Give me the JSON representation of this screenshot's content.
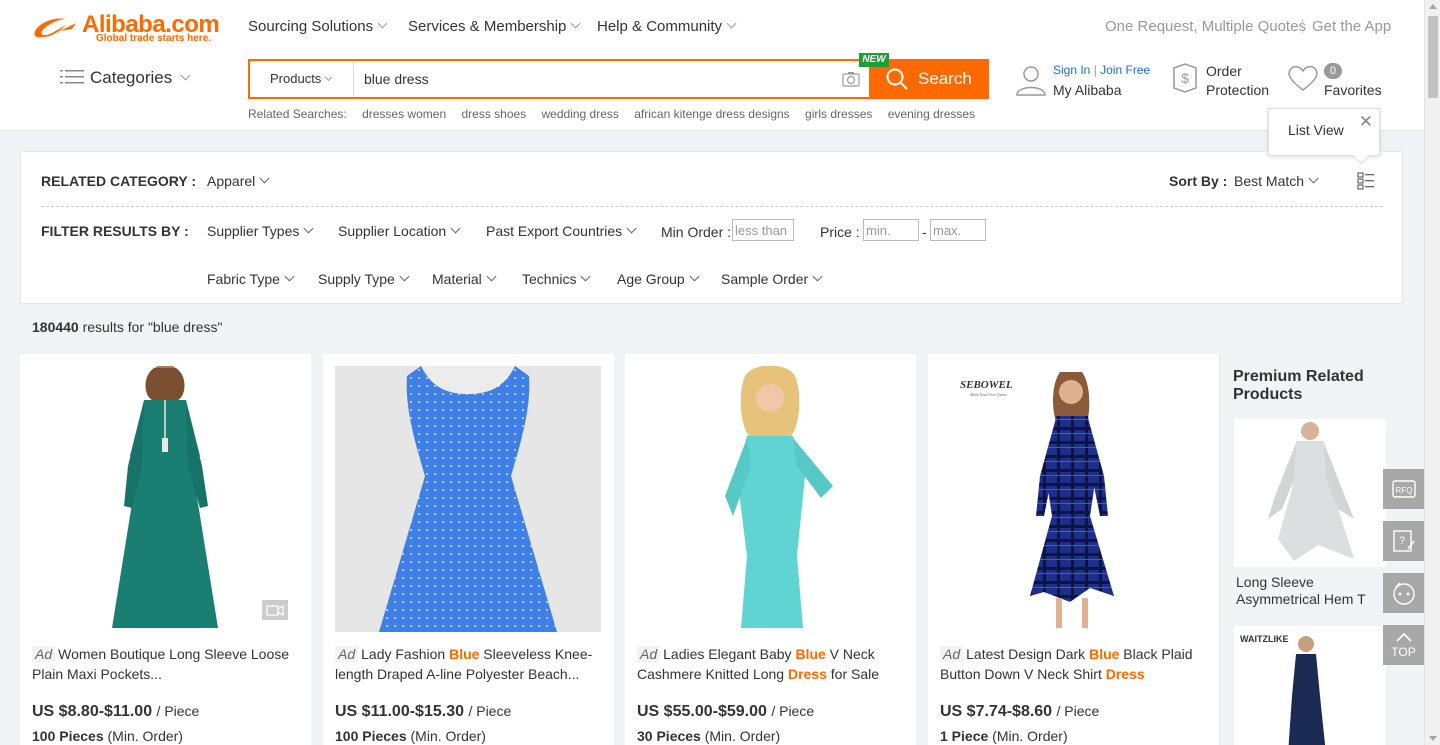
{
  "brand": {
    "name": "Alibaba.com",
    "tagline": "Global trade starts here.",
    "accent": "#ff6a00"
  },
  "topnav": {
    "sourcing": "Sourcing Solutions",
    "services": "Services & Membership",
    "help": "Help & Community",
    "one_request": "One Request, Multiple Quotes",
    "get_app": "Get the App"
  },
  "categories_label": "Categories",
  "search": {
    "type": "Products",
    "query": "blue dress",
    "button": "Search",
    "new_badge": "NEW",
    "related_label": "Related Searches:",
    "related": [
      "dresses women",
      "dress shoes",
      "wedding dress",
      "african kitenge dress designs",
      "girls dresses",
      "evening dresses"
    ]
  },
  "account": {
    "sign_in": "Sign In",
    "join_free": "Join Free",
    "my_alibaba": "My Alibaba"
  },
  "order_protection": {
    "line1": "Order",
    "line2": "Protection"
  },
  "favorites": {
    "label": "Favorites",
    "count": "0"
  },
  "list_view_tip": "List View",
  "filters": {
    "related_category_label": "RELATED CATEGORY :",
    "related_category_value": "Apparel",
    "sort_by_label": "Sort By :",
    "sort_by_value": "Best Match",
    "filter_by_label": "FILTER RESULTS BY :",
    "row1": [
      "Supplier Types",
      "Supplier Location",
      "Past Export Countries"
    ],
    "min_order_label": "Min Order :",
    "min_order_placeholder": "less than",
    "price_label": "Price :",
    "price_min_placeholder": "min.",
    "price_dash": "-",
    "price_max_placeholder": "max.",
    "row2": [
      "Fabric Type",
      "Supply Type",
      "Material",
      "Technics",
      "Age Group",
      "Sample Order"
    ]
  },
  "results": {
    "count": "180440",
    "text": "results for \"blue dress\""
  },
  "products": [
    {
      "ad": "Ad",
      "title_pre": "Women Boutique Long Sleeve Loose Plain Maxi Pockets...",
      "hl": "",
      "title_mid": "",
      "hl2": "",
      "title_post": "",
      "price": "US $8.80-$11.00",
      "unit": "/ Piece",
      "moq": "100 Pieces",
      "moq_suffix": "(Min. Order)"
    },
    {
      "ad": "Ad",
      "title_pre": "Lady Fashion ",
      "hl": "Blue",
      "title_mid": " Sleeveless Knee-length Draped A-line Polyester Beach...",
      "hl2": "",
      "title_post": "",
      "price": "US $11.00-$15.30",
      "unit": "/ Piece",
      "moq": "100 Pieces",
      "moq_suffix": "(Min. Order)"
    },
    {
      "ad": "Ad",
      "title_pre": "Ladies Elegant Baby ",
      "hl": "Blue",
      "title_mid": " V Neck Cashmere Knitted Long ",
      "hl2": "Dress",
      "title_post": " for Sale",
      "price": "US $55.00-$59.00",
      "unit": "/ Piece",
      "moq": "30 Pieces",
      "moq_suffix": "(Min. Order)"
    },
    {
      "ad": "Ad",
      "title_pre": "Latest Design Dark ",
      "hl": "Blue",
      "title_mid": " Black Plaid Button Down V Neck Shirt ",
      "hl2": "Dress",
      "title_post": "",
      "price": "US $7.74-$8.60",
      "unit": "/ Piece",
      "moq": "1 Piece",
      "moq_suffix": "(Min. Order)"
    }
  ],
  "product_brand_logo": {
    "name": "SEBOWEL",
    "tag": "Make Your Own Queen"
  },
  "premium": {
    "title": "Premium Related Products",
    "item1": "Long Sleeve Asymmetrical Hem T",
    "item2_brand": "WAITZLIKE"
  },
  "floating": {
    "rfq": "RFQ",
    "top": "TOP"
  }
}
